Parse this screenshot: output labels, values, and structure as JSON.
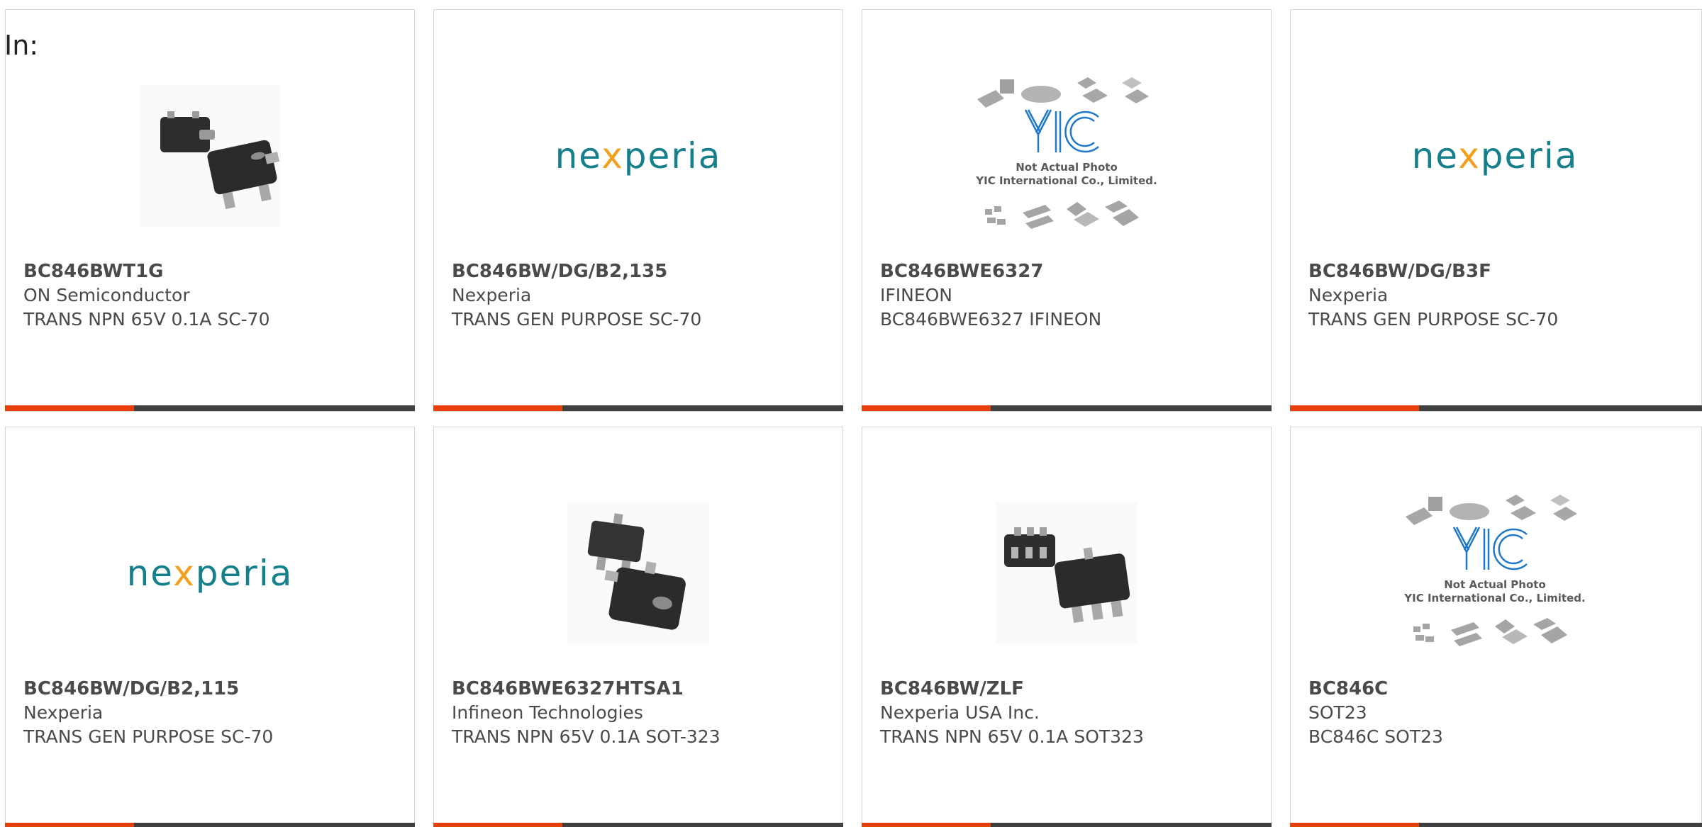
{
  "header": {
    "label": "In:"
  },
  "products": [
    {
      "part_number": "BC846BWT1G",
      "manufacturer": "ON Semiconductor",
      "description": "TRANS NPN 65V 0.1A SC-70",
      "image": "sc70-3pin-transistor-photo"
    },
    {
      "part_number": "BC846BW/DG/B2,135",
      "manufacturer": "Nexperia",
      "description": "TRANS GEN PURPOSE SC-70",
      "image": "nexperia-logo"
    },
    {
      "part_number": "BC846BWE6327",
      "manufacturer": "IFINEON",
      "description": "BC846BWE6327 IFINEON",
      "image": "yic-placeholder"
    },
    {
      "part_number": "BC846BW/DG/B3F",
      "manufacturer": "Nexperia",
      "description": "TRANS GEN PURPOSE SC-70",
      "image": "nexperia-logo"
    },
    {
      "part_number": "BC846BW/DG/B2,115",
      "manufacturer": "Nexperia",
      "description": "TRANS GEN PURPOSE SC-70",
      "image": "nexperia-logo"
    },
    {
      "part_number": "BC846BWE6327HTSA1",
      "manufacturer": "Infineon Technologies",
      "description": "TRANS NPN 65V 0.1A SOT-323",
      "image": "sot323-transistor-photo"
    },
    {
      "part_number": "BC846BW/ZLF",
      "manufacturer": "Nexperia USA Inc.",
      "description": "TRANS NPN 65V 0.1A SOT323",
      "image": "sc70-6pin-transistor-photo"
    },
    {
      "part_number": "BC846C",
      "manufacturer": "SOT23",
      "description": "BC846C SOT23",
      "image": "yic-placeholder"
    }
  ],
  "logos": {
    "nexperia": {
      "before": "ne",
      "x": "x",
      "after": "peria"
    },
    "yic": {
      "mark": "YIC",
      "line1": "Not Actual Photo",
      "line2": "YIC International Co., Limited."
    }
  },
  "colors": {
    "accent": "#e8400c",
    "bar": "#404040",
    "text": "#4a4a4a",
    "nexperia_teal": "#15808c",
    "nexperia_orange": "#f2a01e",
    "yic_blue": "#1f78c8"
  }
}
